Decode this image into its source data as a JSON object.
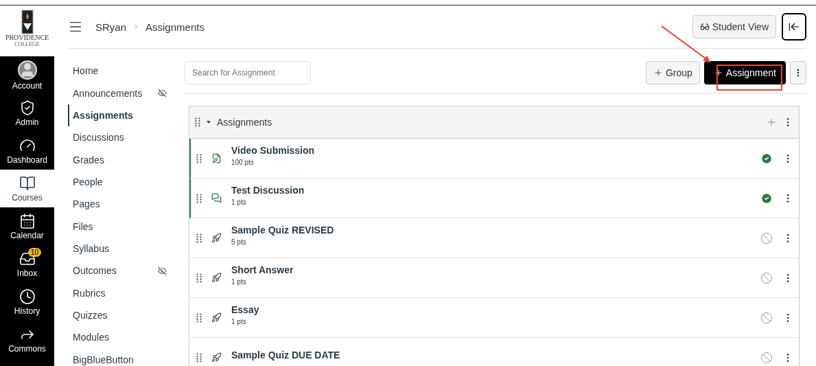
{
  "logo": {
    "name": "PROVIDENCE",
    "subtitle": "COLLEGE"
  },
  "global_nav": [
    {
      "label": "Account",
      "selected": false
    },
    {
      "label": "Admin",
      "selected": false
    },
    {
      "label": "Dashboard",
      "selected": false
    },
    {
      "label": "Courses",
      "selected": true
    },
    {
      "label": "Calendar",
      "selected": false
    },
    {
      "label": "Inbox",
      "selected": false,
      "badge": "10"
    },
    {
      "label": "History",
      "selected": false
    },
    {
      "label": "Commons",
      "selected": false
    }
  ],
  "breadcrumb": [
    "SRyan",
    "Assignments"
  ],
  "header_buttons": {
    "student_view": "Student View"
  },
  "course_nav": [
    {
      "label": "Home",
      "selected": false,
      "hidden": false
    },
    {
      "label": "Announcements",
      "selected": false,
      "hidden": true
    },
    {
      "label": "Assignments",
      "selected": true,
      "hidden": false
    },
    {
      "label": "Discussions",
      "selected": false,
      "hidden": false
    },
    {
      "label": "Grades",
      "selected": false,
      "hidden": false
    },
    {
      "label": "People",
      "selected": false,
      "hidden": false
    },
    {
      "label": "Pages",
      "selected": false,
      "hidden": false
    },
    {
      "label": "Files",
      "selected": false,
      "hidden": false
    },
    {
      "label": "Syllabus",
      "selected": false,
      "hidden": false
    },
    {
      "label": "Outcomes",
      "selected": false,
      "hidden": true
    },
    {
      "label": "Rubrics",
      "selected": false,
      "hidden": false
    },
    {
      "label": "Quizzes",
      "selected": false,
      "hidden": false
    },
    {
      "label": "Modules",
      "selected": false,
      "hidden": false
    },
    {
      "label": "BigBlueButton",
      "selected": false,
      "hidden": false
    }
  ],
  "search": {
    "placeholder": "Search for Assignment"
  },
  "toolbar": {
    "group_button": "Group",
    "assignment_button": "Assignment"
  },
  "group": {
    "title": "Assignments",
    "expanded": true,
    "rows": [
      {
        "kind": "assignment",
        "title": "Video Submission",
        "points": "100 pts",
        "published": true
      },
      {
        "kind": "discussion",
        "title": "Test Discussion",
        "points": "1 pts",
        "published": true
      },
      {
        "kind": "quiz",
        "title": "Sample Quiz REVISED",
        "points": "5 pts",
        "published": false
      },
      {
        "kind": "quiz",
        "title": "Short Answer",
        "points": "1 pts",
        "published": false
      },
      {
        "kind": "quiz",
        "title": "Essay",
        "points": "1 pts",
        "published": false
      },
      {
        "kind": "quiz",
        "title": "Sample Quiz DUE DATE",
        "published": false
      }
    ]
  }
}
